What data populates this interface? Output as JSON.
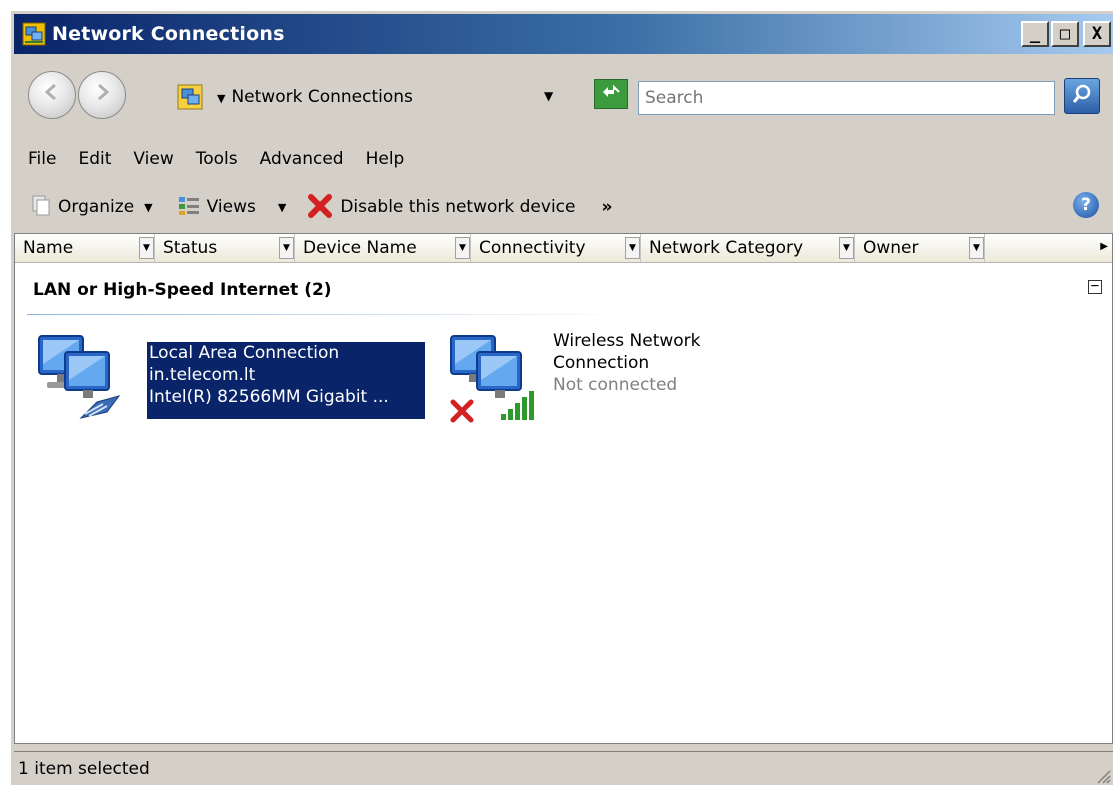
{
  "window": {
    "title": "Network Connections",
    "buttons": {
      "minimize": "_",
      "maximize": "□",
      "close": "X"
    }
  },
  "address": {
    "path_label": "Network Connections",
    "search_placeholder": "Search"
  },
  "menu": [
    "File",
    "Edit",
    "View",
    "Tools",
    "Advanced",
    "Help"
  ],
  "toolbar": {
    "organize_label": "Organize",
    "views_label": "Views",
    "disable_label": "Disable this network device",
    "more_label": "»"
  },
  "columns": [
    "Name",
    "Status",
    "Device Name",
    "Connectivity",
    "Network Category",
    "Owner"
  ],
  "group": {
    "header": "LAN or High-Speed Internet (2)"
  },
  "items": [
    {
      "name": "Local Area Connection",
      "line2": "in.telecom.lt",
      "line3": "Intel(R) 82566MM Gigabit ...",
      "selected": true
    },
    {
      "name_line1": "Wireless Network",
      "name_line2": "Connection",
      "status": "Not connected",
      "selected": false
    }
  ],
  "status_bar": {
    "text": "1 item selected"
  },
  "colors": {
    "title_gradient_start": "#0a246a",
    "title_gradient_end": "#a6caf0",
    "selection": "#0a246a",
    "window_face": "#d4d0c8"
  }
}
